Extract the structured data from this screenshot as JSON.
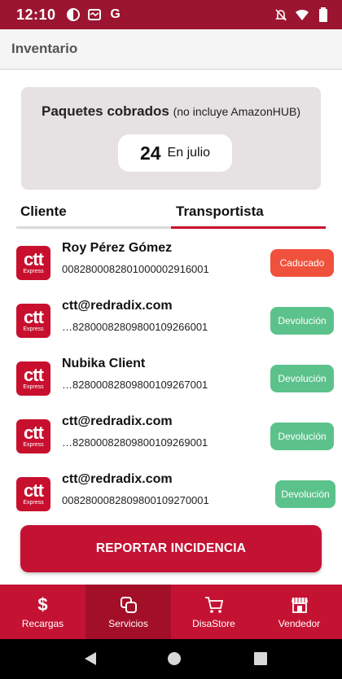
{
  "status_bar": {
    "time": "12:10",
    "left_icons": [
      "hotspot-icon",
      "message-icon",
      "google-g-icon"
    ],
    "right_icons": [
      "mute-icon",
      "wifi-icon",
      "battery-icon"
    ],
    "g_letter": "G"
  },
  "app_bar": {
    "title": "Inventario"
  },
  "summary": {
    "heading": "Paquetes cobrados",
    "note": "(no incluye AmazonHUB)",
    "count": "24",
    "period": "En julio"
  },
  "tabs": [
    {
      "label": "Cliente",
      "active": false
    },
    {
      "label": "Transportista",
      "active": true
    }
  ],
  "logo": {
    "text": "ctt",
    "subtext": "Express"
  },
  "items": [
    {
      "name": "Roy Pérez Gómez",
      "code": "00828000828010000029160​01",
      "status": "Caducado",
      "status_color": "#f0513c"
    },
    {
      "name": "ctt@redradix.com",
      "code": "…8280008280980010926600​1",
      "status": "Devolución",
      "status_color": "#5cc28b"
    },
    {
      "name": "Nubika Client",
      "code": "…8280008280980010926700​1",
      "status": "Devolución",
      "status_color": "#5cc28b"
    },
    {
      "name": "ctt@redradix.com",
      "code": "…8280008280980010926900​1",
      "status": "Devolución",
      "status_color": "#5cc28b"
    },
    {
      "name": "ctt@redradix.com",
      "code": "0082800082809800109270001",
      "status": "Devolución",
      "status_color": "#5cc28b"
    }
  ],
  "report_button": {
    "label": "REPORTAR INCIDENCIA"
  },
  "bottom_nav": [
    {
      "label": "Recargas",
      "icon": "dollar-icon",
      "glyph": "$",
      "active": false
    },
    {
      "label": "Servicios",
      "icon": "services-icon",
      "active": true
    },
    {
      "label": "DisaStore",
      "icon": "cart-icon",
      "active": false
    },
    {
      "label": "Vendedor",
      "icon": "store-icon",
      "active": false
    }
  ],
  "colors": {
    "brand": "#c41233",
    "status_bar": "#9b1530",
    "expired": "#f0513c",
    "return": "#5cc28b"
  }
}
